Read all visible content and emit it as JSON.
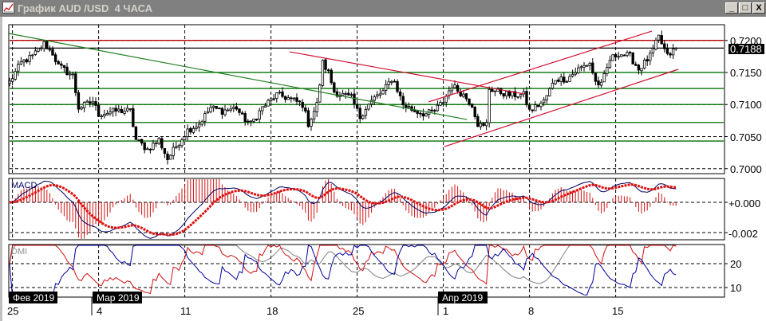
{
  "window": {
    "title": "График AUD /USD  4 ЧАСА",
    "minimize_label": "_",
    "maximize_label": "□",
    "close_label": "X"
  },
  "price_axis": {
    "labels": [
      "0.7200",
      "0.7150",
      "0.7100",
      "0.7050",
      "0.7000"
    ],
    "last_price": "0.7188"
  },
  "macd_panel": {
    "name": "MACD",
    "labels": [
      "+0.000",
      "-0.002"
    ]
  },
  "dmi_panel": {
    "name": "DMI",
    "labels": [
      "20",
      "10"
    ]
  },
  "time_axis": {
    "months": [
      "Фев 2019",
      "Мар 2019",
      "Апр 2019"
    ],
    "days": [
      "25",
      "4",
      "11",
      "18",
      "25",
      "1",
      "8",
      "15"
    ]
  },
  "colors": {
    "bull_body": "#ffffff",
    "bear_body": "#000000",
    "resistance": "#c00000",
    "support_green": "#007000",
    "trend_red": "#d01030",
    "trend_green": "#208020",
    "macd_line": "#000060",
    "macd_signal": "#e01010",
    "macd_hist": "#d01010",
    "dmi_plus": "#d01010",
    "dmi_minus": "#0000a0",
    "adx": "#808080"
  },
  "chart_data": {
    "type": "candlestick",
    "title": "AUD/USD 4H",
    "ylim": [
      0.699,
      0.7225
    ],
    "yticks": [
      0.72,
      0.715,
      0.71,
      0.705,
      0.7
    ],
    "bars": 233,
    "week_starts_bar": [
      1,
      31,
      61,
      91,
      121,
      151,
      181,
      211
    ],
    "month_start_bars": [
      0,
      29,
      150
    ],
    "close_anchors": [
      [
        0,
        0.7135
      ],
      [
        4,
        0.7165
      ],
      [
        8,
        0.7175
      ],
      [
        12,
        0.7195
      ],
      [
        15,
        0.718
      ],
      [
        17,
        0.716
      ],
      [
        22,
        0.7145
      ],
      [
        24,
        0.7095
      ],
      [
        29,
        0.7105
      ],
      [
        31,
        0.7085
      ],
      [
        37,
        0.709
      ],
      [
        42,
        0.709
      ],
      [
        44,
        0.7045
      ],
      [
        48,
        0.703
      ],
      [
        52,
        0.7045
      ],
      [
        55,
        0.7015
      ],
      [
        58,
        0.7035
      ],
      [
        62,
        0.706
      ],
      [
        66,
        0.707
      ],
      [
        70,
        0.7095
      ],
      [
        74,
        0.709
      ],
      [
        79,
        0.7095
      ],
      [
        81,
        0.708
      ],
      [
        84,
        0.707
      ],
      [
        88,
        0.7095
      ],
      [
        93,
        0.7115
      ],
      [
        97,
        0.711
      ],
      [
        102,
        0.71
      ],
      [
        104,
        0.707
      ],
      [
        107,
        0.71
      ],
      [
        109,
        0.7165
      ],
      [
        111,
        0.715
      ],
      [
        113,
        0.712
      ],
      [
        119,
        0.711
      ],
      [
        122,
        0.708
      ],
      [
        124,
        0.7095
      ],
      [
        127,
        0.711
      ],
      [
        130,
        0.712
      ],
      [
        133,
        0.714
      ],
      [
        134,
        0.7135
      ],
      [
        137,
        0.71
      ],
      [
        141,
        0.709
      ],
      [
        145,
        0.7085
      ],
      [
        148,
        0.709
      ],
      [
        151,
        0.7105
      ],
      [
        154,
        0.713
      ],
      [
        158,
        0.7115
      ],
      [
        161,
        0.71
      ],
      [
        163,
        0.707
      ],
      [
        165,
        0.7065
      ],
      [
        166,
        0.707
      ],
      [
        167,
        0.7125
      ],
      [
        170,
        0.712
      ],
      [
        174,
        0.7115
      ],
      [
        179,
        0.7115
      ],
      [
        181,
        0.709
      ],
      [
        186,
        0.7105
      ],
      [
        190,
        0.714
      ],
      [
        194,
        0.714
      ],
      [
        198,
        0.7155
      ],
      [
        202,
        0.7165
      ],
      [
        204,
        0.7135
      ],
      [
        206,
        0.713
      ],
      [
        209,
        0.717
      ],
      [
        212,
        0.718
      ],
      [
        216,
        0.7175
      ],
      [
        219,
        0.7155
      ],
      [
        223,
        0.7175
      ],
      [
        226,
        0.7205
      ],
      [
        229,
        0.7175
      ],
      [
        232,
        0.7188
      ]
    ],
    "horizontal_levels": [
      {
        "price": 0.72,
        "kind": "resistance"
      },
      {
        "price": 0.7188,
        "kind": "last"
      },
      {
        "price": 0.715,
        "kind": "support_green"
      },
      {
        "price": 0.7125,
        "kind": "support_green"
      },
      {
        "price": 0.71,
        "kind": "support_green"
      },
      {
        "price": 0.7072,
        "kind": "support_green"
      },
      {
        "price": 0.7043,
        "kind": "support_green"
      }
    ],
    "trendlines": [
      {
        "kind": "trend_green",
        "from": [
          -0.3,
          0.72108
        ],
        "to": [
          159.2,
          0.70766
        ]
      },
      {
        "kind": "trend_red",
        "from": [
          97.5,
          0.71822
        ],
        "to": [
          179.2,
          0.71164
        ]
      },
      {
        "kind": "trend_red",
        "from": [
          145.8,
          0.7104
        ],
        "to": [
          223.6,
          0.72145
        ]
      },
      {
        "kind": "trend_red",
        "from": [
          151.4,
          0.70344
        ],
        "to": [
          232.8,
          0.71549
        ]
      }
    ],
    "macd": {
      "fast": 12,
      "slow": 26,
      "signal": 9,
      "ylim": [
        -0.0024,
        0.0016
      ]
    },
    "dmi": {
      "period": 14,
      "ylim": [
        6,
        28
      ]
    }
  }
}
